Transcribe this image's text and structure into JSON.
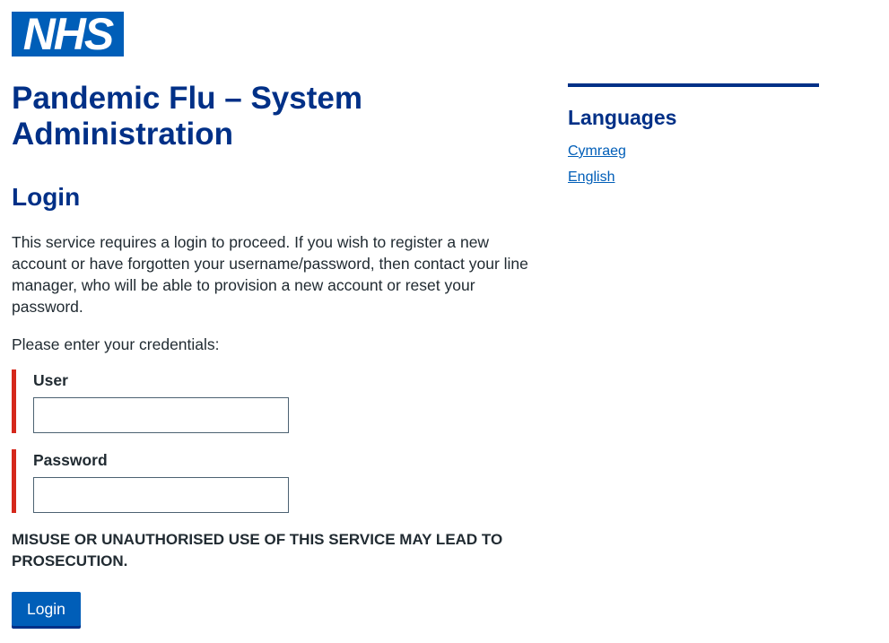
{
  "header": {
    "logo_text": "NHS",
    "logo_color": "#005eb8"
  },
  "main": {
    "page_title": "Pandemic Flu – System Administration",
    "section_title": "Login",
    "intro": "This service requires a login to proceed. If you wish to register a new account or have forgotten your username/password, then contact your line manager, who will be able to provision a new account or reset your password.",
    "prompt": "Please enter your credentials:",
    "fields": [
      {
        "label": "User",
        "value": "",
        "placeholder": ""
      },
      {
        "label": "Password",
        "value": "",
        "placeholder": ""
      }
    ],
    "warning": "MISUSE OR UNAUTHORISED USE OF THIS SERVICE MAY LEAD TO PROSECUTION.",
    "login_button_label": "Login"
  },
  "aside": {
    "title": "Languages",
    "languages": [
      {
        "label": "Cymraeg"
      },
      {
        "label": "English"
      }
    ]
  },
  "colors": {
    "brand_blue": "#005eb8",
    "heading_blue": "#003087",
    "field_accent_red": "#d5281b",
    "text": "#212b32"
  }
}
